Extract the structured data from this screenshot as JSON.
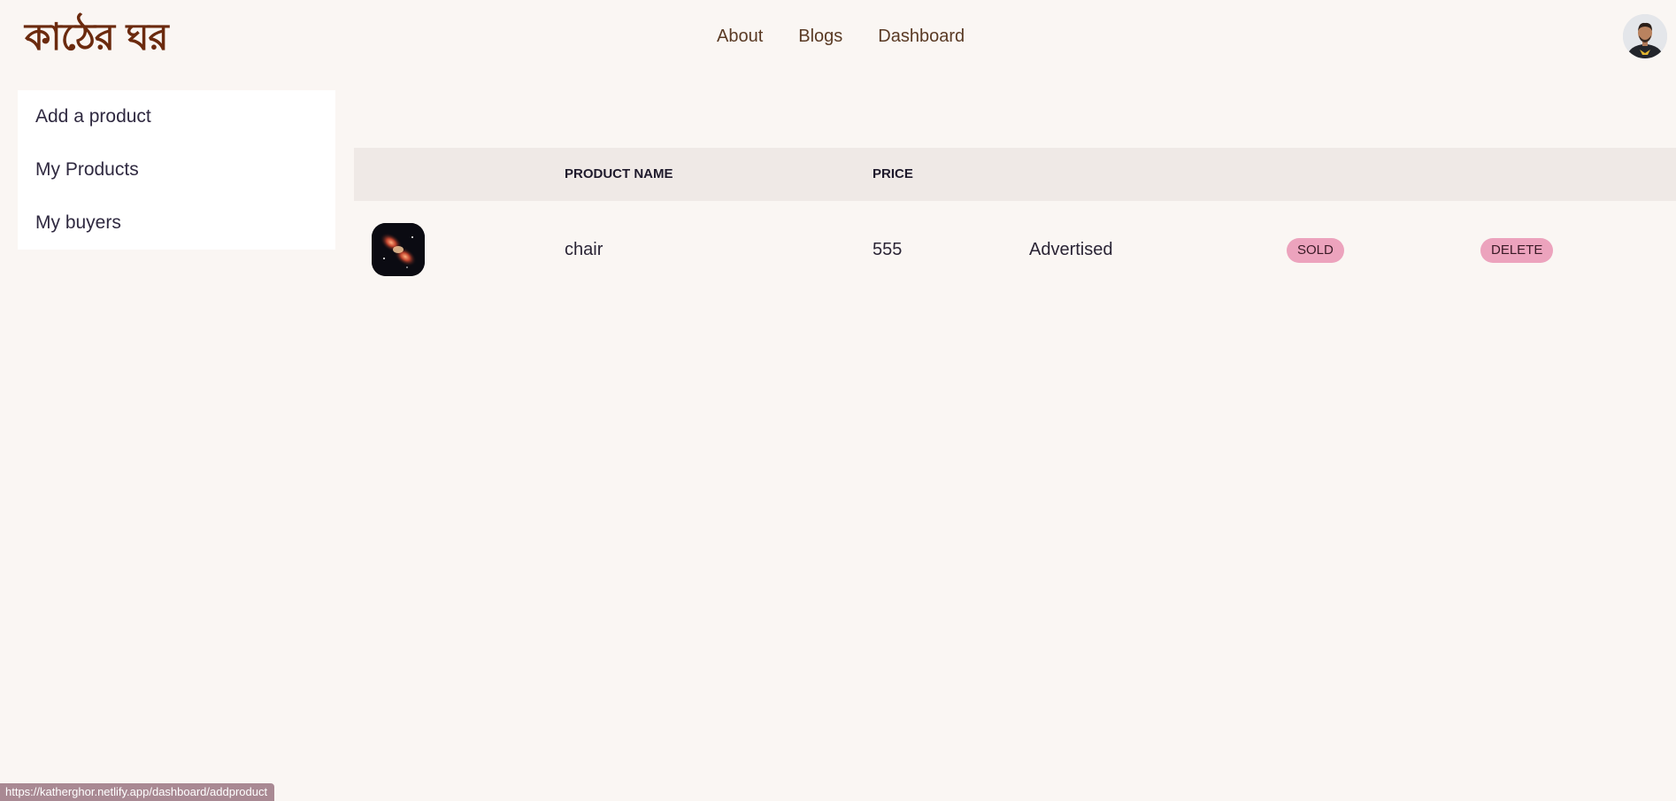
{
  "brand": {
    "logo_text": "কাঠের ঘর",
    "color": "#6b2a0e"
  },
  "nav": {
    "links": [
      {
        "label": "About"
      },
      {
        "label": "Blogs"
      },
      {
        "label": "Dashboard"
      }
    ]
  },
  "user": {
    "avatar_icon": "user-avatar"
  },
  "sidebar": {
    "items": [
      {
        "label": "Add a product"
      },
      {
        "label": "My Products"
      },
      {
        "label": "My buyers"
      }
    ]
  },
  "table": {
    "headers": {
      "image": "",
      "name": "Product Name",
      "price": "Price",
      "status": "",
      "sold": "",
      "delete": ""
    },
    "rows": [
      {
        "image_icon": "product-thumbnail",
        "name": "chair",
        "price": "555",
        "status": "Advertised",
        "sold_label": "SOLD",
        "delete_label": "DELETE"
      }
    ]
  },
  "status_bar": {
    "url": "https://katherghor.netlify.app/dashboard/addproduct"
  },
  "colors": {
    "background": "#faf6f3",
    "table_header": "#efe9e6",
    "pill": "#eca3bd",
    "nav_text": "#5a3a24"
  }
}
